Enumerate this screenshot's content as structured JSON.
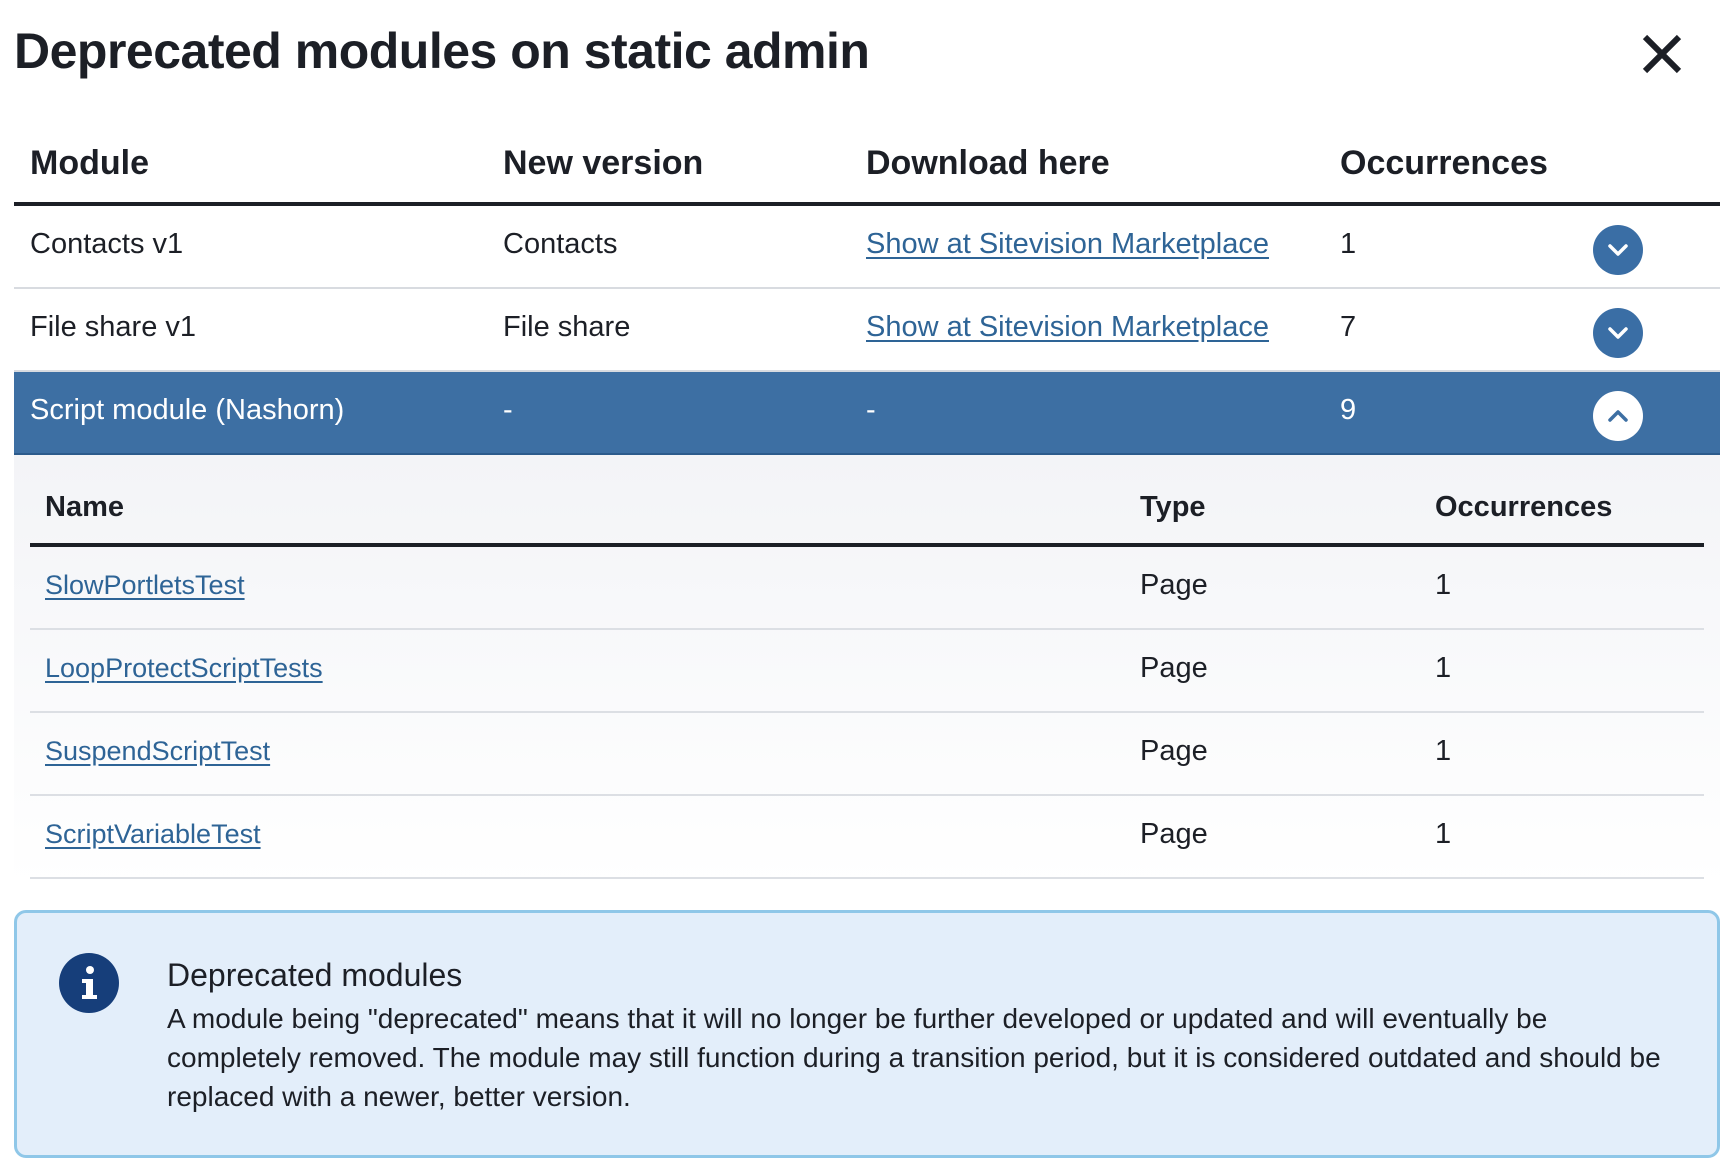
{
  "dialog": {
    "title": "Deprecated modules on static admin",
    "close_icon": "close-icon"
  },
  "main_table": {
    "headers": [
      "Module",
      "New version",
      "Download here",
      "Occurrences"
    ],
    "rows": [
      {
        "module": "Contacts v1",
        "new_version": "Contacts",
        "download": "Show at Sitevision Marketplace",
        "occurrences": "1",
        "expanded": false
      },
      {
        "module": "File share v1",
        "new_version": "File share",
        "download": "Show at Sitevision Marketplace",
        "occurrences": "7",
        "expanded": false
      },
      {
        "module": "Script module (Nashorn)",
        "new_version": "-",
        "download": "-",
        "occurrences": "9",
        "expanded": true
      }
    ]
  },
  "sub_table": {
    "headers": [
      "Name",
      "Type",
      "Occurrences"
    ],
    "rows": [
      {
        "name": "SlowPortletsTest",
        "type": "Page",
        "occurrences": "1"
      },
      {
        "name": "LoopProtectScriptTests",
        "type": "Page",
        "occurrences": "1"
      },
      {
        "name": "SuspendScriptTest",
        "type": "Page",
        "occurrences": "1"
      },
      {
        "name": "ScriptVariableTest",
        "type": "Page",
        "occurrences": "1"
      }
    ]
  },
  "info": {
    "icon": "info-icon",
    "title": "Deprecated modules",
    "text": "A module being \"deprecated\" means that it will no longer be further developed or updated and will eventually be completely removed. The module may still function during a transition period, but it is considered outdated and should be replaced with a newer, better version."
  },
  "colors": {
    "accent": "#3d6fa3",
    "link": "#2e6496",
    "info_bg": "#e3eefa",
    "info_border": "#8fc7e8",
    "info_icon": "#163e7a"
  }
}
